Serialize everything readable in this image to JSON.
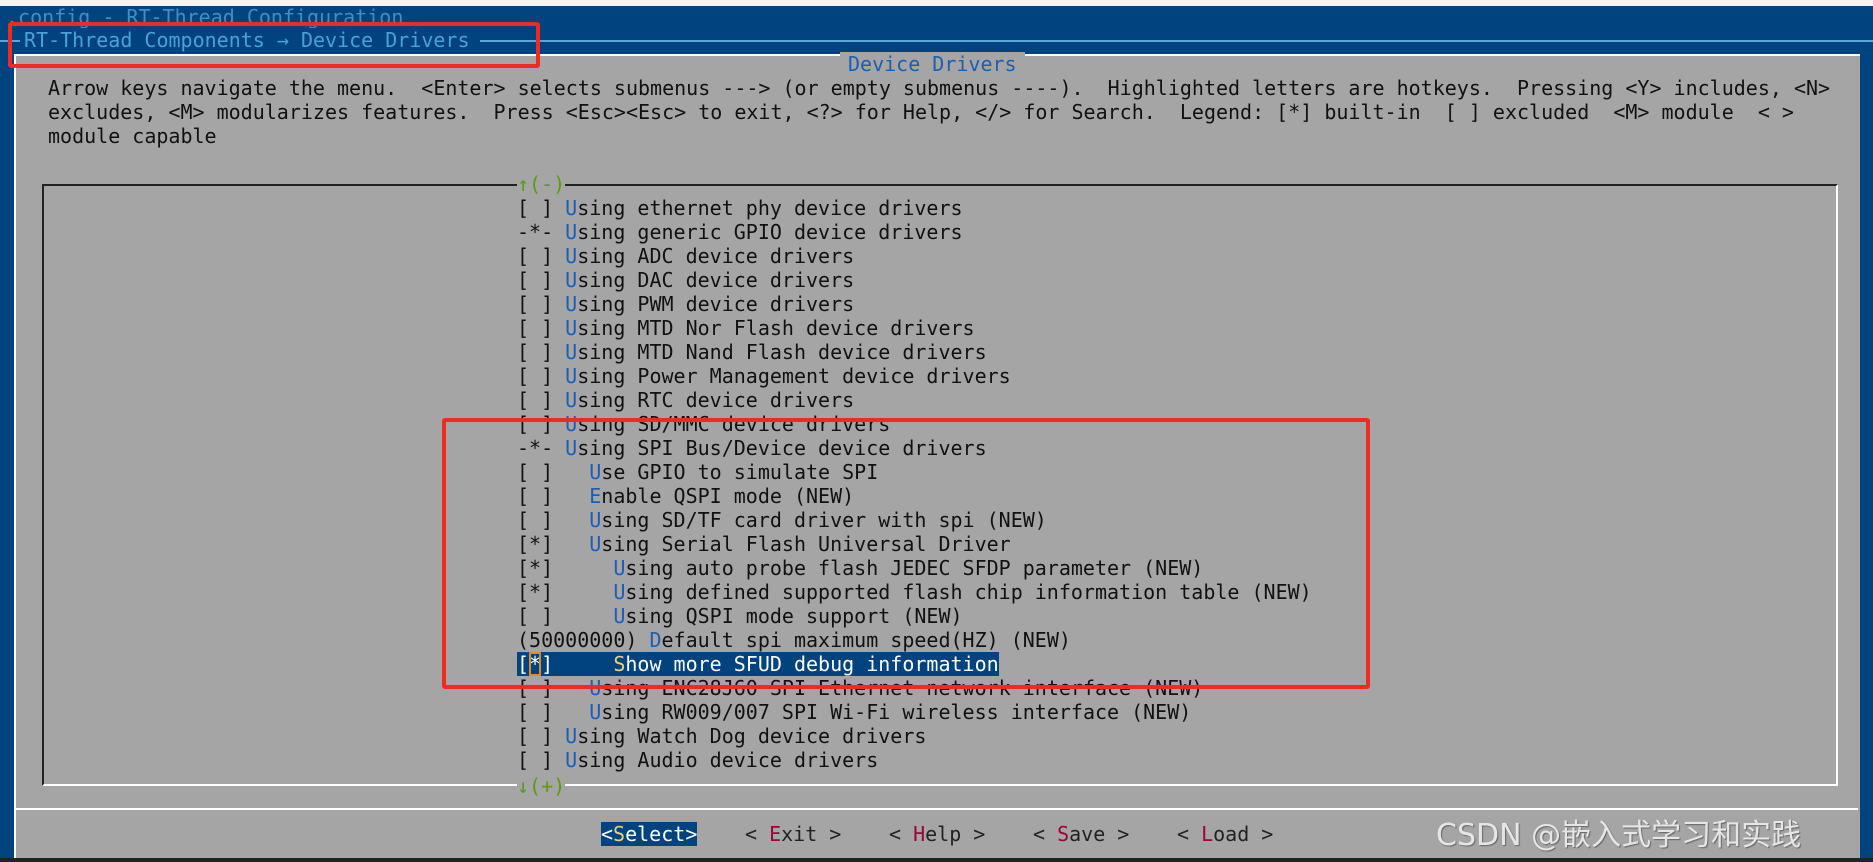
{
  "window_title": ".config - RT-Thread Configuration",
  "breadcrumb": "RT-Thread Components → Device Drivers",
  "dialog_title": "Device Drivers",
  "help_lines": [
    "Arrow keys navigate the menu.  <Enter> selects submenus ---> (or empty submenus ----).  Highlighted letters are hotkeys.  Pressing <Y> includes, <N>",
    "excludes, <M> modularizes features.  Press <Esc><Esc> to exit, <?> for Help, </> for Search.  Legend: [*] built-in  [ ] excluded  <M> module  < >",
    "module capable"
  ],
  "scroll_up": "↑(-)",
  "scroll_down": "↓(+)",
  "items": [
    {
      "prefix": "[ ] ",
      "hotkey": "U",
      "rest": "sing ethernet phy device drivers"
    },
    {
      "prefix": "-*- ",
      "hotkey": "U",
      "rest": "sing generic GPIO device drivers"
    },
    {
      "prefix": "[ ] ",
      "hotkey": "U",
      "rest": "sing ADC device drivers"
    },
    {
      "prefix": "[ ] ",
      "hotkey": "U",
      "rest": "sing DAC device drivers"
    },
    {
      "prefix": "[ ] ",
      "hotkey": "U",
      "rest": "sing PWM device drivers"
    },
    {
      "prefix": "[ ] ",
      "hotkey": "U",
      "rest": "sing MTD Nor Flash device drivers"
    },
    {
      "prefix": "[ ] ",
      "hotkey": "U",
      "rest": "sing MTD Nand Flash device drivers"
    },
    {
      "prefix": "[ ] ",
      "hotkey": "U",
      "rest": "sing Power Management device drivers"
    },
    {
      "prefix": "[ ] ",
      "hotkey": "U",
      "rest": "sing RTC device drivers"
    },
    {
      "prefix": "[ ] ",
      "hotkey": "U",
      "rest": "sing SD/MMC device drivers"
    },
    {
      "prefix": "-*- ",
      "hotkey": "U",
      "rest": "sing SPI Bus/Device device drivers"
    },
    {
      "prefix": "[ ]   ",
      "hotkey": "U",
      "rest": "se GPIO to simulate SPI"
    },
    {
      "prefix": "[ ]   ",
      "hotkey": "E",
      "rest": "nable QSPI mode (NEW)"
    },
    {
      "prefix": "[ ]   ",
      "hotkey": "U",
      "rest": "sing SD/TF card driver with spi (NEW)"
    },
    {
      "prefix": "[*]   ",
      "hotkey": "U",
      "rest": "sing Serial Flash Universal Driver"
    },
    {
      "prefix": "[*]     ",
      "hotkey": "U",
      "rest": "sing auto probe flash JEDEC SFDP parameter (NEW)"
    },
    {
      "prefix": "[*]     ",
      "hotkey": "U",
      "rest": "sing defined supported flash chip information table (NEW)"
    },
    {
      "prefix": "[ ]     ",
      "hotkey": "U",
      "rest": "sing QSPI mode support (NEW)"
    },
    {
      "prefix": "(50000000) ",
      "hotkey": "D",
      "rest": "efault spi maximum speed(HZ) (NEW)"
    },
    {
      "prefix": "[*]     ",
      "hotkey": "S",
      "rest": "how more SFUD debug information",
      "selected": true
    },
    {
      "prefix": "[ ]   ",
      "hotkey": "U",
      "rest": "sing ENC28J60 SPI Ethernet network interface (NEW)"
    },
    {
      "prefix": "[ ]   ",
      "hotkey": "U",
      "rest": "sing RW009/007 SPI Wi-Fi wireless interface (NEW)"
    },
    {
      "prefix": "[ ] ",
      "hotkey": "U",
      "rest": "sing Watch Dog device drivers"
    },
    {
      "prefix": "[ ] ",
      "hotkey": "U",
      "rest": "sing Audio device drivers"
    }
  ],
  "buttons": [
    {
      "open": "<",
      "hotkey": "S",
      "rest": "elect",
      "close": ">",
      "active": true
    },
    {
      "open": "< ",
      "hotkey": "E",
      "rest": "xit",
      "close": " >"
    },
    {
      "open": "< ",
      "hotkey": "H",
      "rest": "elp",
      "close": " >"
    },
    {
      "open": "< ",
      "hotkey": "S",
      "rest": "ave",
      "close": " >"
    },
    {
      "open": "< ",
      "hotkey": "L",
      "rest": "oad",
      "close": " >"
    }
  ],
  "watermark": "CSDN @嵌入式学习和实践",
  "colors": {
    "background": "#00437f",
    "dialog": "#a5a5a5",
    "hotkey": "#1a5fb4",
    "button_hotkey": "#a0003a",
    "annotation": "#f02a22"
  }
}
